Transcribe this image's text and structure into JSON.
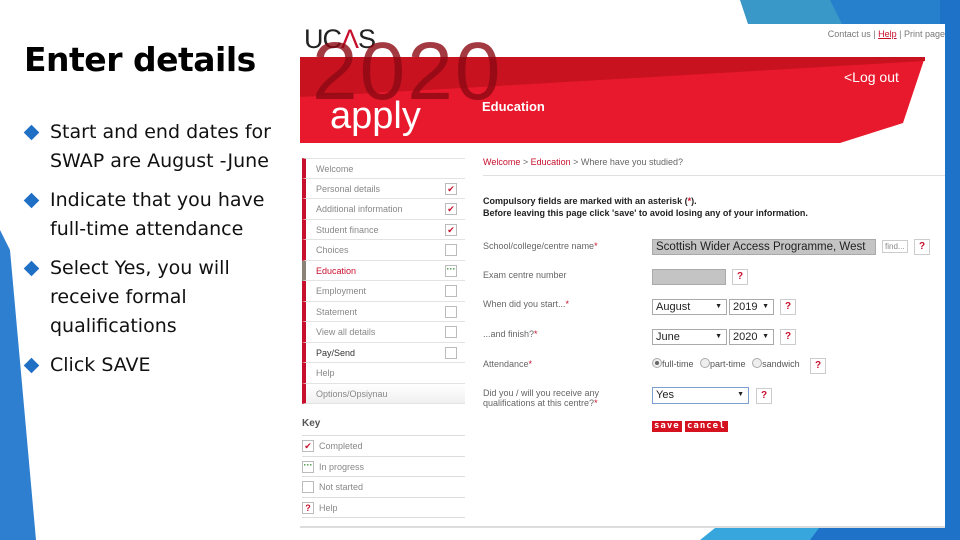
{
  "slide": {
    "title": "Enter details",
    "bullets": [
      "Start and end dates for SWAP are August -June",
      "Indicate that you have full-time attendance",
      "Select Yes, you will receive formal qualifications",
      "Click SAVE"
    ]
  },
  "colors": {
    "accent_blue": "#1f6fc5",
    "ucas_red": "#c8102e",
    "button_red": "#d5121f"
  },
  "ucas": {
    "logo": {
      "pre": "UC",
      "mid": "Λ",
      "post": "S"
    },
    "top_links": {
      "contact": "Contact us",
      "sep1": " | ",
      "help": "Help",
      "sep2": " | ",
      "print": "Print page"
    },
    "banner": {
      "year": "2020",
      "apply": "apply",
      "section": "Education",
      "logout": "<Log out"
    },
    "nav": [
      {
        "label": "Welcome",
        "status": "none"
      },
      {
        "label": "Personal details",
        "status": "completed"
      },
      {
        "label": "Additional information",
        "status": "completed"
      },
      {
        "label": "Student finance",
        "status": "completed"
      },
      {
        "label": "Choices",
        "status": "not-started"
      },
      {
        "label": "Education",
        "status": "in-progress",
        "active": true
      },
      {
        "label": "Employment",
        "status": "not-started"
      },
      {
        "label": "Statement",
        "status": "not-started"
      },
      {
        "label": "View all details",
        "status": "not-started"
      },
      {
        "label": "Pay/Send",
        "status": "not-started"
      },
      {
        "label": "Help",
        "status": "none"
      },
      {
        "label": "Options/Opsiynau",
        "status": "none"
      }
    ],
    "status_glyphs": {
      "completed": "✔",
      "in-progress": "···",
      "not-started": "",
      "help": "?"
    },
    "key": {
      "title": "Key",
      "items": [
        {
          "label": "Completed",
          "status": "completed"
        },
        {
          "label": "In progress",
          "status": "in-progress"
        },
        {
          "label": "Not started",
          "status": "not-started"
        },
        {
          "label": "Help",
          "status": "help"
        }
      ]
    },
    "breadcrumb": {
      "welcome": "Welcome",
      "sep": " > ",
      "education": "Education",
      "current": "Where have you studied?"
    },
    "notice": {
      "line1_a": "Compulsory fields are marked with an asterisk (",
      "asterisk": "*",
      "line1_b": ").",
      "line2": "Before leaving this page click 'save' to avoid losing any of your information."
    },
    "form": {
      "asterisk": "*",
      "help_glyph": "?",
      "school": {
        "label": "School/college/centre name",
        "value": "Scottish Wider Access Programme, West",
        "find_label": "find..."
      },
      "exam_centre": {
        "label": "Exam centre number",
        "value": ""
      },
      "start": {
        "label": "When did you start...",
        "month": "August",
        "year": "2019"
      },
      "finish": {
        "label": "...and finish?",
        "month": "June",
        "year": "2020"
      },
      "attendance": {
        "label": "Attendance",
        "options": [
          "full-time",
          "part-time",
          "sandwich"
        ],
        "selected": "full-time"
      },
      "qualifications": {
        "label_line1": "Did you / will you receive any",
        "label_line2": "qualifications at this centre?",
        "value": "Yes"
      },
      "save_label": "save",
      "cancel_label": "cancel",
      "select_arrow": "▼"
    }
  }
}
